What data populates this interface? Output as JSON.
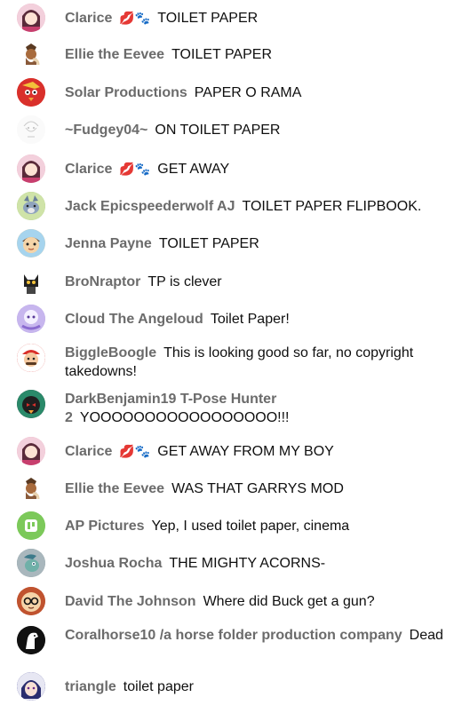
{
  "messages": [
    {
      "author": "Clarice",
      "badges": "💋🐾",
      "text": "TOILET PAPER",
      "avatar": "girl-icon",
      "color": "#e8a3b8"
    },
    {
      "author": "Ellie the Eevee",
      "badges": "",
      "text": "TOILET PAPER",
      "avatar": "eevee-icon",
      "color": "#8a5a3a"
    },
    {
      "author": "Solar Productions",
      "badges": "",
      "text": "PAPER O RAMA",
      "avatar": "bird-icon",
      "color": "#d9302b"
    },
    {
      "author": "~Fudgey04~",
      "badges": "",
      "text": "ON TOILET PAPER",
      "avatar": "sketch-icon",
      "color": "#f4f4f4"
    },
    {
      "author": "Clarice",
      "badges": "💋🐾",
      "text": "GET AWAY",
      "avatar": "girl-icon",
      "color": "#e8a3b8"
    },
    {
      "author": "Jack Epicspeederwolf AJ",
      "badges": "",
      "text": "TOILET PAPER FLIPBOOK.",
      "avatar": "wolf-icon",
      "color": "#9bc46a"
    },
    {
      "author": "Jenna Payne",
      "badges": "",
      "text": "TOILET PAPER",
      "avatar": "villager-icon",
      "color": "#f2c98a"
    },
    {
      "author": "BroNraptor",
      "badges": "",
      "text": "TP is clever",
      "avatar": "cat-icon",
      "color": "#e8e8e8"
    },
    {
      "author": "Cloud The Angeloud",
      "badges": "",
      "text": "Toilet Paper!",
      "avatar": "cloud-icon",
      "color": "#b29ae0"
    },
    {
      "author": "BiggleBoogle",
      "badges": "",
      "text": "This is looking good so far, no copyright takedowns!",
      "avatar": "mario-icon",
      "color": "#d9302b"
    },
    {
      "author": "DarkBenjamin19 T-Pose Hunter 2",
      "badges": "",
      "text": "YOOOOOOOOOOOOOOOOO!!!",
      "avatar": "bird-dark-icon",
      "color": "#2f3a3a"
    },
    {
      "author": "Clarice",
      "badges": "💋🐾",
      "text": "GET AWAY FROM MY BOY",
      "avatar": "girl-icon",
      "color": "#e8a3b8"
    },
    {
      "author": "Ellie the Eevee",
      "badges": "",
      "text": "WAS THAT GARRYS MOD",
      "avatar": "eevee-icon",
      "color": "#8a5a3a"
    },
    {
      "author": "AP Pictures",
      "badges": "",
      "text": "Yep, I used toilet paper, cinema",
      "avatar": "ap-logo-icon",
      "color": "#7cc95a"
    },
    {
      "author": "Joshua Rocha",
      "badges": "",
      "text": "THE MIGHTY ACORNS-",
      "avatar": "pony-icon",
      "color": "#7a8a8f"
    },
    {
      "author": "David The Johnson",
      "badges": "",
      "text": "Where did Buck get a gun?",
      "avatar": "glasses-icon",
      "color": "#b84a2e"
    },
    {
      "author": "Coralhorse10 /a horse folder production company",
      "badges": "",
      "text": "Dead",
      "avatar": "horse-icon",
      "color": "#111111"
    },
    {
      "author": "triangle",
      "badges": "",
      "text": "toilet paper",
      "avatar": "anime-icon",
      "color": "#3b3e8f"
    }
  ]
}
